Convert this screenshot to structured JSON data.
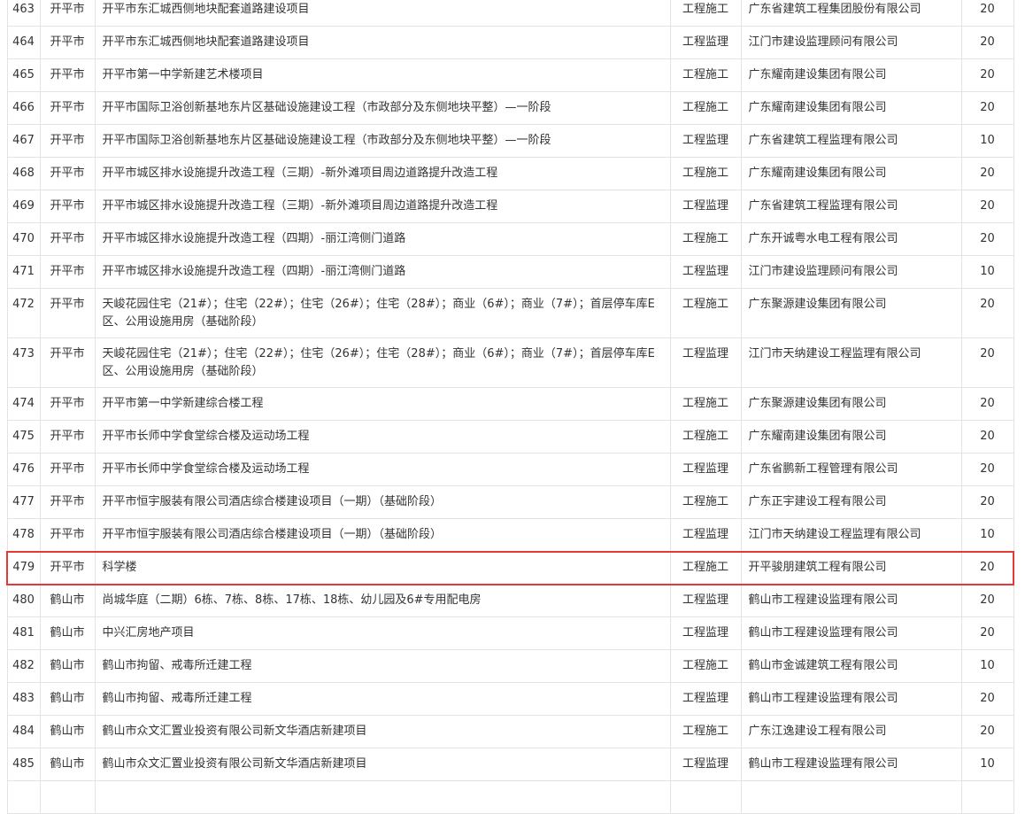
{
  "table": {
    "rows": [
      {
        "no": "463",
        "city": "开平市",
        "project": "开平市东汇城西侧地块配套道路建设项目",
        "type": "工程施工",
        "company": "广东省建筑工程集团股份有限公司",
        "score": "20"
      },
      {
        "no": "464",
        "city": "开平市",
        "project": "开平市东汇城西侧地块配套道路建设项目",
        "type": "工程监理",
        "company": "江门市建设监理顾问有限公司",
        "score": "20"
      },
      {
        "no": "465",
        "city": "开平市",
        "project": "开平市第一中学新建艺术楼项目",
        "type": "工程施工",
        "company": "广东耀南建设集团有限公司",
        "score": "20"
      },
      {
        "no": "466",
        "city": "开平市",
        "project": "开平市国际卫浴创新基地东片区基础设施建设工程（市政部分及东侧地块平整）—一阶段",
        "type": "工程施工",
        "company": "广东耀南建设集团有限公司",
        "score": "20"
      },
      {
        "no": "467",
        "city": "开平市",
        "project": "开平市国际卫浴创新基地东片区基础设施建设工程（市政部分及东侧地块平整）—一阶段",
        "type": "工程监理",
        "company": "广东省建筑工程监理有限公司",
        "score": "10"
      },
      {
        "no": "468",
        "city": "开平市",
        "project": "开平市城区排水设施提升改造工程（三期）-新外滩项目周边道路提升改造工程",
        "type": "工程施工",
        "company": "广东耀南建设集团有限公司",
        "score": "20"
      },
      {
        "no": "469",
        "city": "开平市",
        "project": "开平市城区排水设施提升改造工程（三期）-新外滩项目周边道路提升改造工程",
        "type": "工程监理",
        "company": "广东省建筑工程监理有限公司",
        "score": "20"
      },
      {
        "no": "470",
        "city": "开平市",
        "project": "开平市城区排水设施提升改造工程（四期）-丽江湾侧门道路",
        "type": "工程施工",
        "company": "广东开诚粤水电工程有限公司",
        "score": "20"
      },
      {
        "no": "471",
        "city": "开平市",
        "project": "开平市城区排水设施提升改造工程（四期）-丽江湾侧门道路",
        "type": "工程监理",
        "company": "江门市建设监理顾问有限公司",
        "score": "10"
      },
      {
        "no": "472",
        "city": "开平市",
        "project": "天峻花园住宅（21#）；住宅（22#）；住宅（26#）；住宅（28#）；商业（6#）；商业（7#）；首层停车库E区、公用设施用房（基础阶段）",
        "type": "工程施工",
        "company": "广东聚源建设集团有限公司",
        "score": "20"
      },
      {
        "no": "473",
        "city": "开平市",
        "project": "天峻花园住宅（21#）；住宅（22#）；住宅（26#）；住宅（28#）；商业（6#）；商业（7#）；首层停车库E区、公用设施用房（基础阶段）",
        "type": "工程监理",
        "company": "江门市天纳建设工程监理有限公司",
        "score": "20"
      },
      {
        "no": "474",
        "city": "开平市",
        "project": "开平市第一中学新建综合楼工程",
        "type": "工程施工",
        "company": "广东聚源建设集团有限公司",
        "score": "20"
      },
      {
        "no": "475",
        "city": "开平市",
        "project": "开平市长师中学食堂综合楼及运动场工程",
        "type": "工程施工",
        "company": "广东耀南建设集团有限公司",
        "score": "20"
      },
      {
        "no": "476",
        "city": "开平市",
        "project": "开平市长师中学食堂综合楼及运动场工程",
        "type": "工程监理",
        "company": "广东省鹏新工程管理有限公司",
        "score": "20"
      },
      {
        "no": "477",
        "city": "开平市",
        "project": "开平市恒宇服装有限公司酒店综合楼建设项目（一期）（基础阶段）",
        "type": "工程施工",
        "company": "广东正宇建设工程有限公司",
        "score": "20"
      },
      {
        "no": "478",
        "city": "开平市",
        "project": "开平市恒宇服装有限公司酒店综合楼建设项目（一期）（基础阶段）",
        "type": "工程监理",
        "company": "江门市天纳建设工程监理有限公司",
        "score": "10"
      },
      {
        "no": "479",
        "city": "开平市",
        "project": "科学楼",
        "type": "工程施工",
        "company": "开平骏朋建筑工程有限公司",
        "score": "20"
      },
      {
        "no": "480",
        "city": "鹤山市",
        "project": "尚城华庭（二期）6栋、7栋、8栋、17栋、18栋、幼儿园及6#专用配电房",
        "type": "工程监理",
        "company": "鹤山市工程建设监理有限公司",
        "score": "20"
      },
      {
        "no": "481",
        "city": "鹤山市",
        "project": "中兴汇房地产项目",
        "type": "工程监理",
        "company": "鹤山市工程建设监理有限公司",
        "score": "20"
      },
      {
        "no": "482",
        "city": "鹤山市",
        "project": "鹤山市拘留、戒毒所迁建工程",
        "type": "工程施工",
        "company": "鹤山市金诚建筑工程有限公司",
        "score": "10"
      },
      {
        "no": "483",
        "city": "鹤山市",
        "project": "鹤山市拘留、戒毒所迁建工程",
        "type": "工程监理",
        "company": "鹤山市工程建设监理有限公司",
        "score": "20"
      },
      {
        "no": "484",
        "city": "鹤山市",
        "project": "鹤山市众文汇置业投资有限公司新文华酒店新建项目",
        "type": "工程施工",
        "company": "广东江逸建设工程有限公司",
        "score": "20"
      },
      {
        "no": "485",
        "city": "鹤山市",
        "project": "鹤山市众文汇置业投资有限公司新文华酒店新建项目",
        "type": "工程监理",
        "company": "鹤山市工程建设监理有限公司",
        "score": "10"
      },
      {
        "no": "",
        "city": "",
        "project": "",
        "type": "",
        "company": "",
        "score": ""
      }
    ],
    "highlight_color": "#e53935"
  }
}
